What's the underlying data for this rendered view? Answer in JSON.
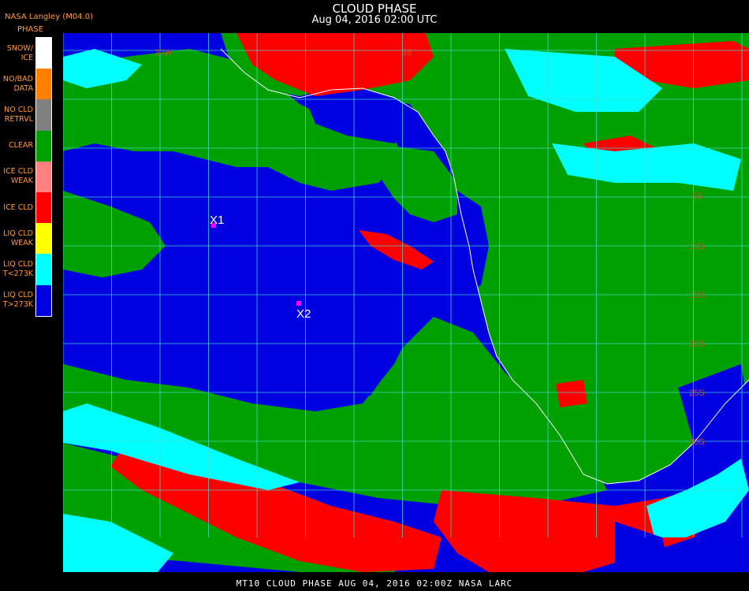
{
  "header": {
    "title": "CLOUD PHASE",
    "datetime": "Aug 04, 2016 02:00 UTC",
    "org": "NASA Langley (M04.0)"
  },
  "legend": {
    "title": "PHASE",
    "items": [
      {
        "label": "SNOW/\nICE",
        "color": "#ffffff"
      },
      {
        "label": "NO/BAD\nDATA",
        "color": "#ff7f00"
      },
      {
        "label": "NO CLD\nRETRVL",
        "color": "#808080"
      },
      {
        "label": "CLEAR",
        "color": "#00a000"
      },
      {
        "label": "ICE CLD\nWEAK",
        "color": "#ff8080"
      },
      {
        "label": "ICE CLD",
        "color": "#ff0000"
      },
      {
        "label": "LIQ CLD\nWEAK",
        "color": "#ffff00"
      },
      {
        "label": "LIQ CLD\nT<273K",
        "color": "#00ffff"
      },
      {
        "label": "LIQ CLD\nT>273K",
        "color": "#0000e0"
      }
    ]
  },
  "map": {
    "lat_labels": [
      "5S",
      "10S",
      "15S",
      "20S",
      "25S",
      "30S"
    ],
    "lon_labels": [
      "20W",
      "5E"
    ],
    "markers": [
      {
        "label": "X1",
        "color": "#ff00ff"
      },
      {
        "label": "X2",
        "color": "#ff00ff"
      }
    ]
  },
  "footer": "MT10  CLOUD PHASE   AUG 04, 2016 02:00Z   NASA LARC"
}
